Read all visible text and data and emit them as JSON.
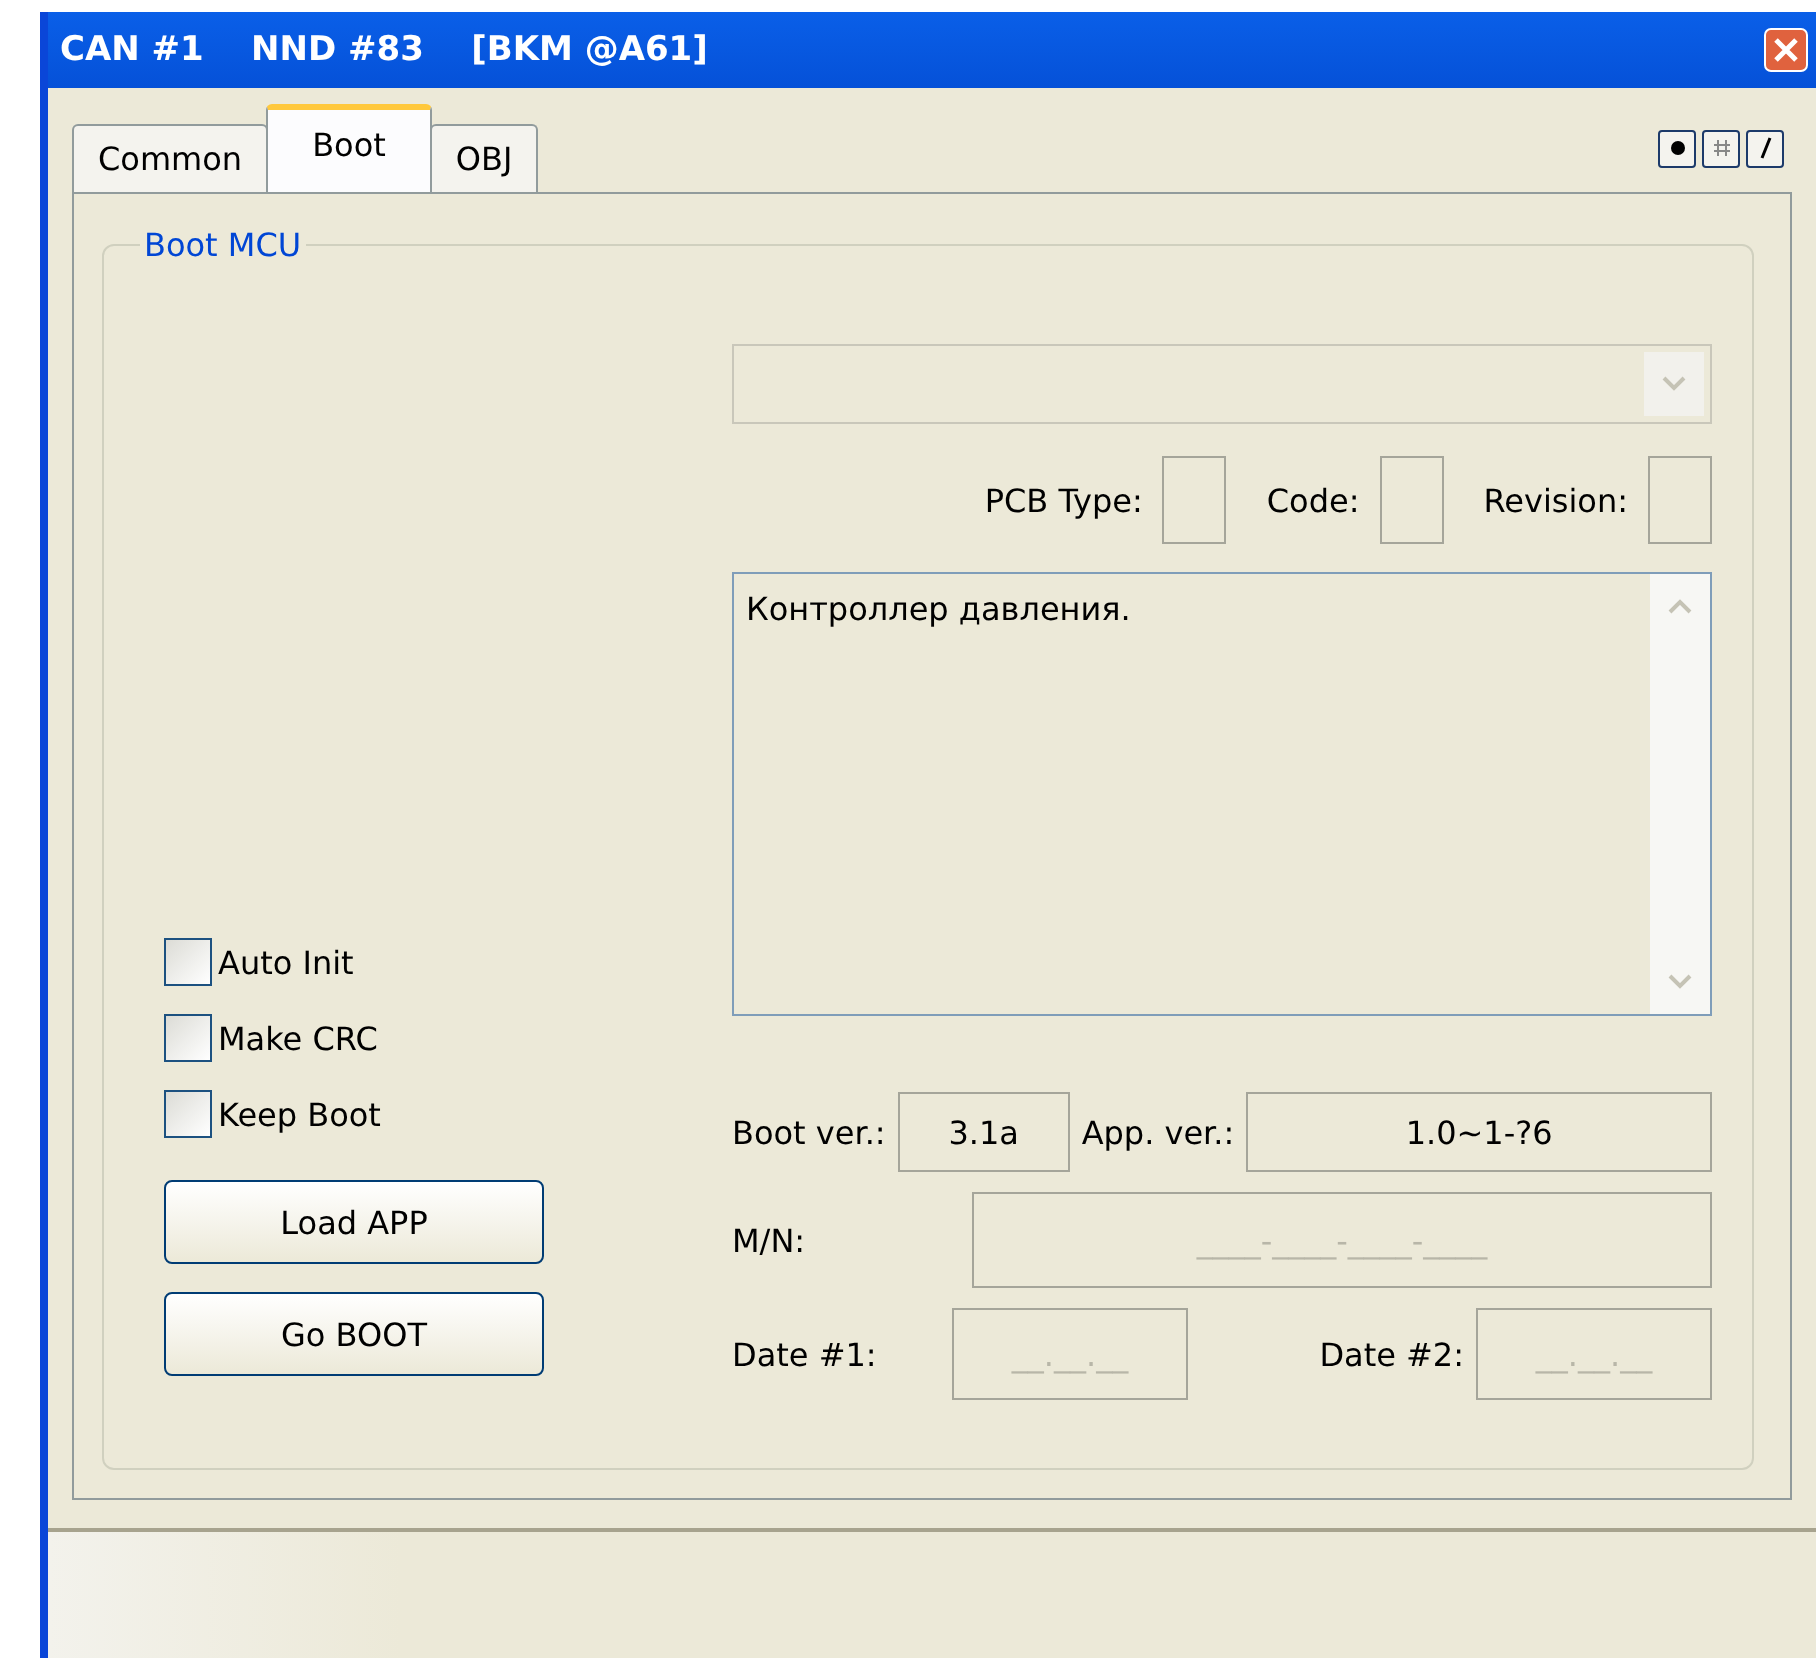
{
  "window": {
    "title": "CAN #1    NND #83    [BKM @A61]"
  },
  "tabs": [
    {
      "label": "Common",
      "selected": false
    },
    {
      "label": "Boot",
      "selected": true
    },
    {
      "label": "OBJ",
      "selected": false
    }
  ],
  "view_buttons": [
    {
      "kind": "dot",
      "selected": false
    },
    {
      "kind": "hash",
      "selected": false
    },
    {
      "kind": "slash",
      "selected": false
    }
  ],
  "group": {
    "title": "Boot MCU"
  },
  "device_dropdown": {
    "disabled": true
  },
  "pcb": [
    {
      "label": "PCB Type:"
    },
    {
      "label": "Code:"
    },
    {
      "label": "Revision:"
    }
  ],
  "description": "Контроллер давления.",
  "options": [
    {
      "label": "Auto Init",
      "checked": false
    },
    {
      "label": "Make CRC",
      "checked": false
    },
    {
      "label": "Keep Boot",
      "checked": false
    }
  ],
  "buttons": [
    "Load APP",
    "Go BOOT"
  ],
  "boot_ver": {
    "label": "Boot ver.:",
    "value": "3.1a"
  },
  "app_ver": {
    "label": "App. ver.:",
    "value": "1.0~1-?6"
  },
  "mn": {
    "label": "M/N:",
    "placeholder": "____-____-____-____"
  },
  "dates": [
    {
      "label": "Date #1:",
      "placeholder": "__.__.__"
    },
    {
      "label": "Date #2:",
      "placeholder": "__.__.__"
    }
  ]
}
